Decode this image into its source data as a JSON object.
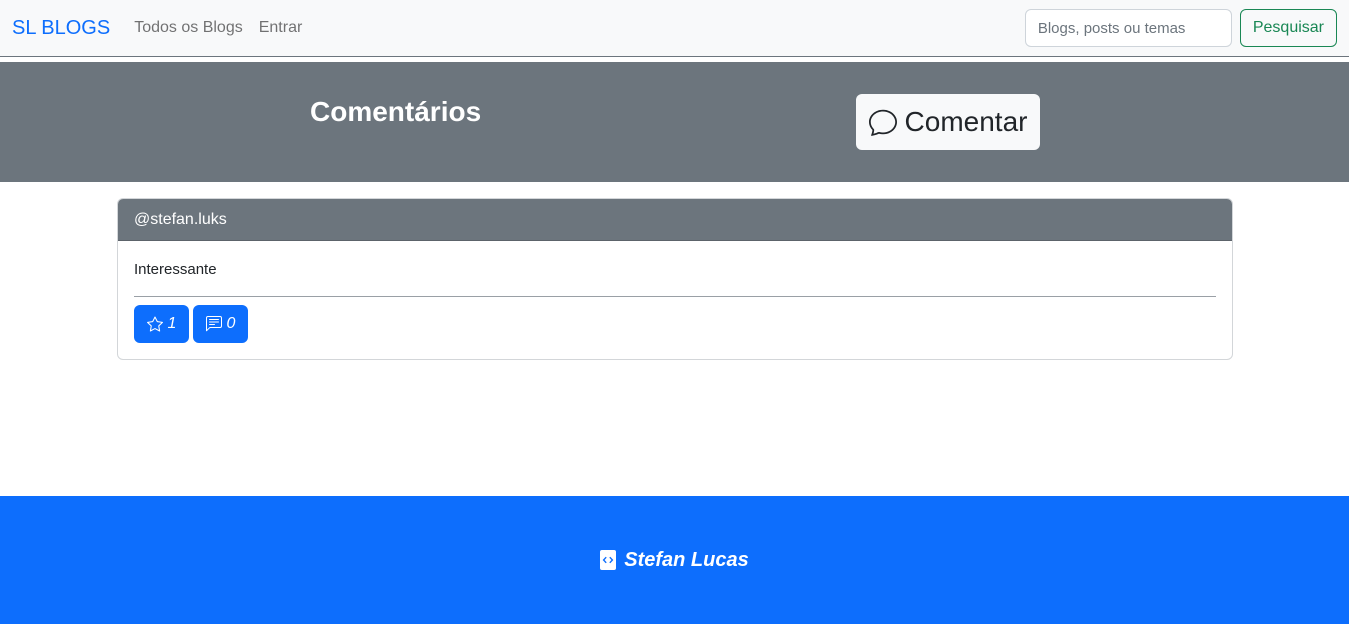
{
  "navbar": {
    "brand": "SL BLOGS",
    "links": [
      "Todos os Blogs",
      "Entrar"
    ],
    "search_placeholder": "Blogs, posts ou temas",
    "search_button": "Pesquisar"
  },
  "banner": {
    "title": "Comentários",
    "comment_button": "Comentar",
    "comment_icon": "chat-bubble-icon"
  },
  "comment": {
    "author": "@stefan.luks",
    "text": "Interessante",
    "likes": "1",
    "replies": "0",
    "like_icon": "star-icon",
    "reply_icon": "message-icon"
  },
  "footer": {
    "author": "Stefan Lucas",
    "icon": "code-icon"
  },
  "colors": {
    "primary": "#0d6efd",
    "secondary": "#6c757d",
    "success": "#198754",
    "light": "#f8f9fa"
  }
}
